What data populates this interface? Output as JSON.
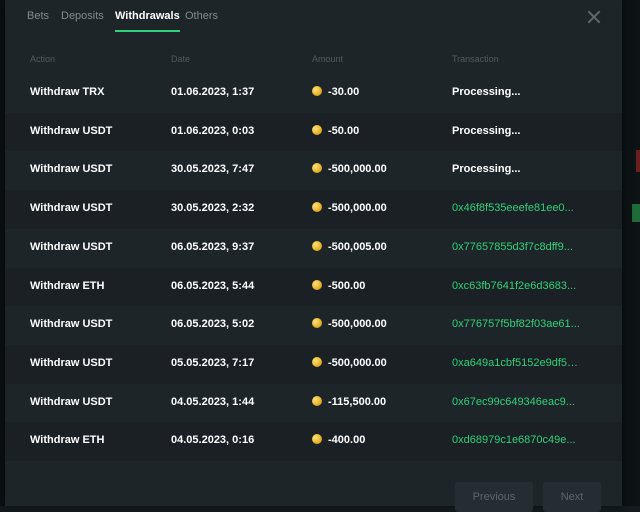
{
  "tabs": [
    {
      "label": "Bets"
    },
    {
      "label": "Deposits"
    },
    {
      "label": "Withdrawals"
    },
    {
      "label": "Others"
    }
  ],
  "active_tab": "Withdrawals",
  "columns": {
    "action": "Action",
    "date": "Date",
    "amount": "Amount",
    "transaction": "Transaction"
  },
  "rows": [
    {
      "action": "Withdraw TRX",
      "date": "01.06.2023, 1:37",
      "amount": "-30.00",
      "transaction": "Processing..."
    },
    {
      "action": "Withdraw USDT",
      "date": "01.06.2023, 0:03",
      "amount": "-50.00",
      "transaction": "Processing..."
    },
    {
      "action": "Withdraw USDT",
      "date": "30.05.2023, 7:47",
      "amount": "-500,000.00",
      "transaction": "Processing..."
    },
    {
      "action": "Withdraw USDT",
      "date": "30.05.2023, 2:32",
      "amount": "-500,000.00",
      "transaction": "0x46f8f535eeefe81ee0..."
    },
    {
      "action": "Withdraw USDT",
      "date": "06.05.2023, 9:37",
      "amount": "-500,005.00",
      "transaction": "0x77657855d3f7c8dff9..."
    },
    {
      "action": "Withdraw ETH",
      "date": "06.05.2023, 5:44",
      "amount": "-500.00",
      "transaction": "0xc63fb7641f2e6d3683..."
    },
    {
      "action": "Withdraw USDT",
      "date": "06.05.2023, 5:02",
      "amount": "-500,000.00",
      "transaction": "0x776757f5bf82f03ae61..."
    },
    {
      "action": "Withdraw USDT",
      "date": "05.05.2023, 7:17",
      "amount": "-500,000.00",
      "transaction": "0xa649a1cbf5152e9df53..."
    },
    {
      "action": "Withdraw USDT",
      "date": "04.05.2023, 1:44",
      "amount": "-115,500.00",
      "transaction": "0x67ec99c649346eac9..."
    },
    {
      "action": "Withdraw ETH",
      "date": "04.05.2023, 0:16",
      "amount": "-400.00",
      "transaction": "0xd68979c1e6870c49e..."
    }
  ],
  "pager": {
    "previous": "Previous",
    "next": "Next"
  },
  "colors": {
    "accent": "#2fd17a",
    "modal_bg": "#1e2529",
    "coin": "#f0b429"
  }
}
